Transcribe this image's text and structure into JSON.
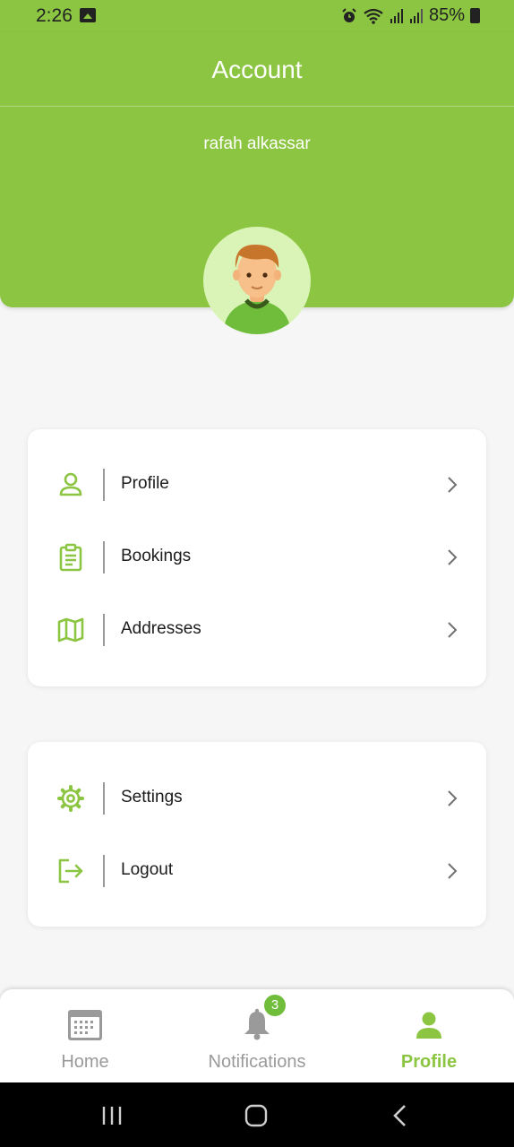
{
  "status_bar": {
    "time": "2:26",
    "battery": "85%"
  },
  "header": {
    "title": "Account",
    "user_name": "rafah alkassar"
  },
  "menu_group_1": [
    {
      "label": "Profile",
      "icon": "user-outline-icon"
    },
    {
      "label": "Bookings",
      "icon": "clipboard-icon"
    },
    {
      "label": "Addresses",
      "icon": "map-icon"
    }
  ],
  "menu_group_2": [
    {
      "label": "Settings",
      "icon": "gear-icon"
    },
    {
      "label": "Logout",
      "icon": "logout-icon"
    }
  ],
  "bottom_nav": {
    "home": "Home",
    "notifications": "Notifications",
    "notifications_badge": "3",
    "profile": "Profile",
    "active": "Profile"
  },
  "colors": {
    "accent": "#8bc541",
    "inactive": "#9a9a9a",
    "badge": "#6fbd3b"
  }
}
